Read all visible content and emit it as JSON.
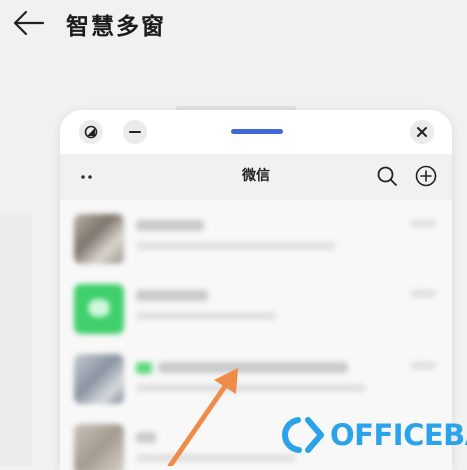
{
  "header": {
    "title": "智慧多窗"
  },
  "window_controls": {
    "drag_handle_color": "#3f68d6"
  },
  "app": {
    "title": "微信"
  },
  "chat_list": {
    "items": [
      {
        "avatar": "photo-avatar",
        "state": "blurred"
      },
      {
        "avatar": "green-chat-avatar",
        "state": "blurred"
      },
      {
        "avatar": "photo-avatar",
        "state": "blurred"
      },
      {
        "avatar": "photo-avatar",
        "state": "blurred"
      }
    ]
  },
  "annotation": {
    "arrow_color": "#f08c4a"
  },
  "watermark": {
    "text": "OFFICEBA",
    "color": "#2aa3ea"
  }
}
